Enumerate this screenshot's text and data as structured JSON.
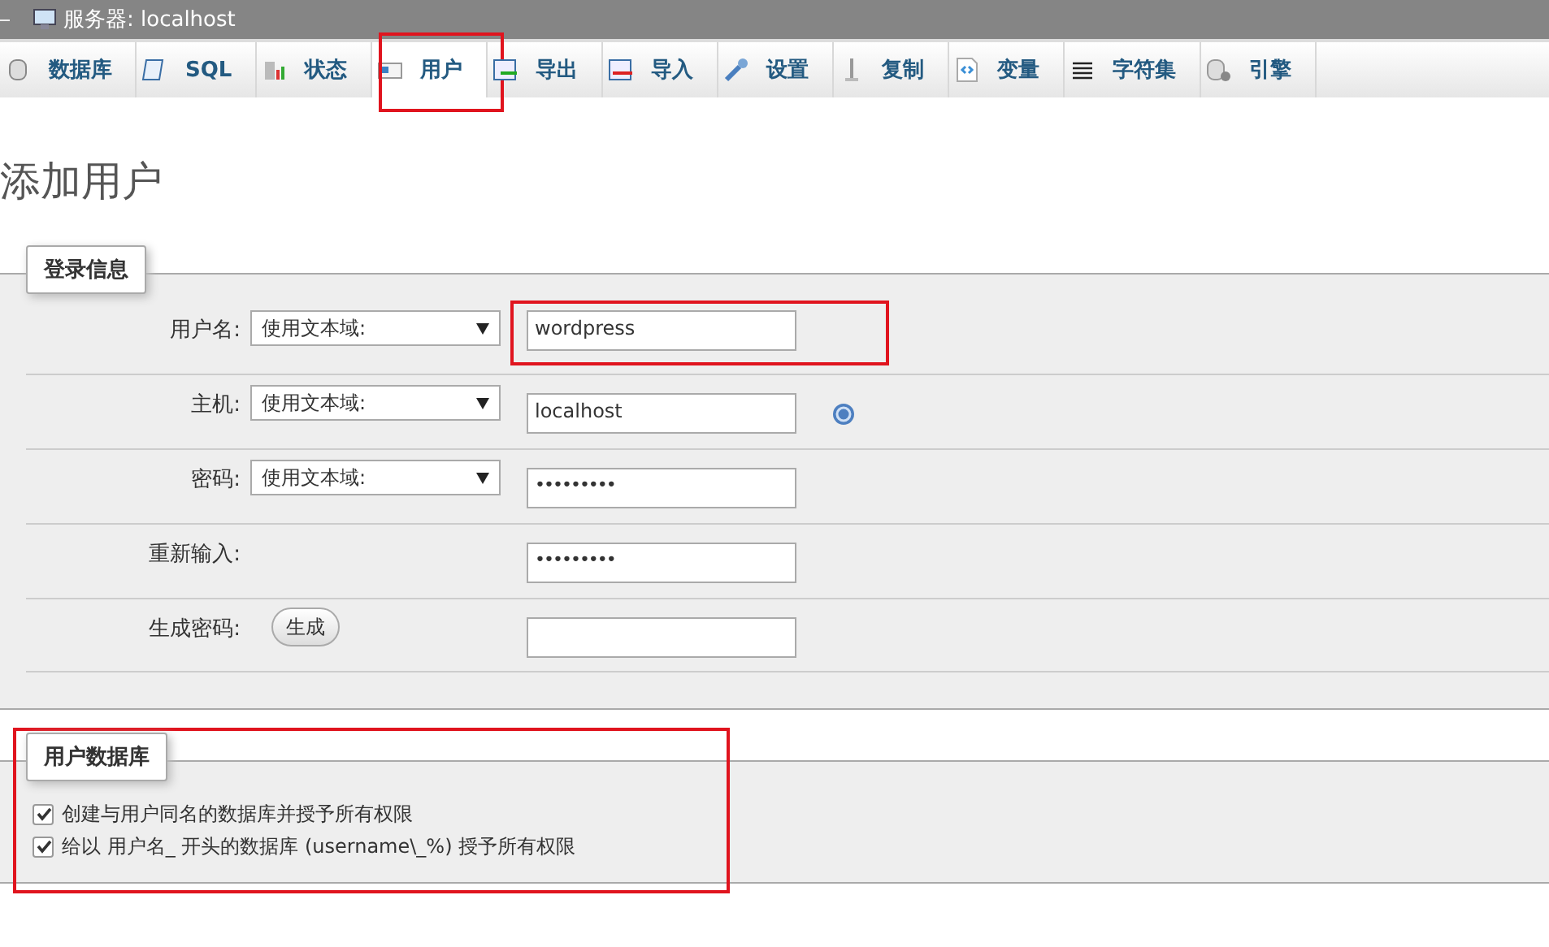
{
  "window": {
    "title": "服务器: localhost"
  },
  "tabs": [
    {
      "label": "数据库",
      "selected": false,
      "highlighted": false
    },
    {
      "label": "SQL",
      "selected": false,
      "highlighted": false
    },
    {
      "label": "状态",
      "selected": false,
      "highlighted": false
    },
    {
      "label": "用户",
      "selected": true,
      "highlighted": true
    },
    {
      "label": "导出",
      "selected": false,
      "highlighted": false
    },
    {
      "label": "导入",
      "selected": false,
      "highlighted": false
    },
    {
      "label": "设置",
      "selected": false,
      "highlighted": false
    },
    {
      "label": "复制",
      "selected": false,
      "highlighted": false
    },
    {
      "label": "变量",
      "selected": false,
      "highlighted": false
    },
    {
      "label": "字符集",
      "selected": false,
      "highlighted": false
    },
    {
      "label": "引擎",
      "selected": false,
      "highlighted": false
    }
  ],
  "heading": "添加用户",
  "login_info": {
    "legend": "登录信息",
    "rows": [
      {
        "label": "用户名:",
        "select": "使用文本域:",
        "kind": "text",
        "value": "wordpress",
        "help": false,
        "highlighted": true
      },
      {
        "label": "主机:",
        "select": "使用文本域:",
        "kind": "text",
        "value": "localhost",
        "help": true,
        "highlighted": false
      },
      {
        "label": "密码:",
        "select": "使用文本域:",
        "kind": "password",
        "value": "•••••••••",
        "help": false,
        "highlighted": false
      },
      {
        "label": "重新输入:",
        "kind": "password",
        "value": "•••••••••",
        "help": false,
        "highlighted": false
      },
      {
        "label": "生成密码:",
        "button": "生成",
        "kind": "text",
        "help": false,
        "highlighted": false
      }
    ]
  },
  "user_database": {
    "legend": "用户数据库",
    "highlighted": true,
    "options": [
      {
        "label": "创建与用户同名的数据库并授予所有权限",
        "checked": true
      },
      {
        "label": "给以 用户名_ 开头的数据库 (username\\_%) 授予所有权限",
        "checked": true
      }
    ]
  }
}
